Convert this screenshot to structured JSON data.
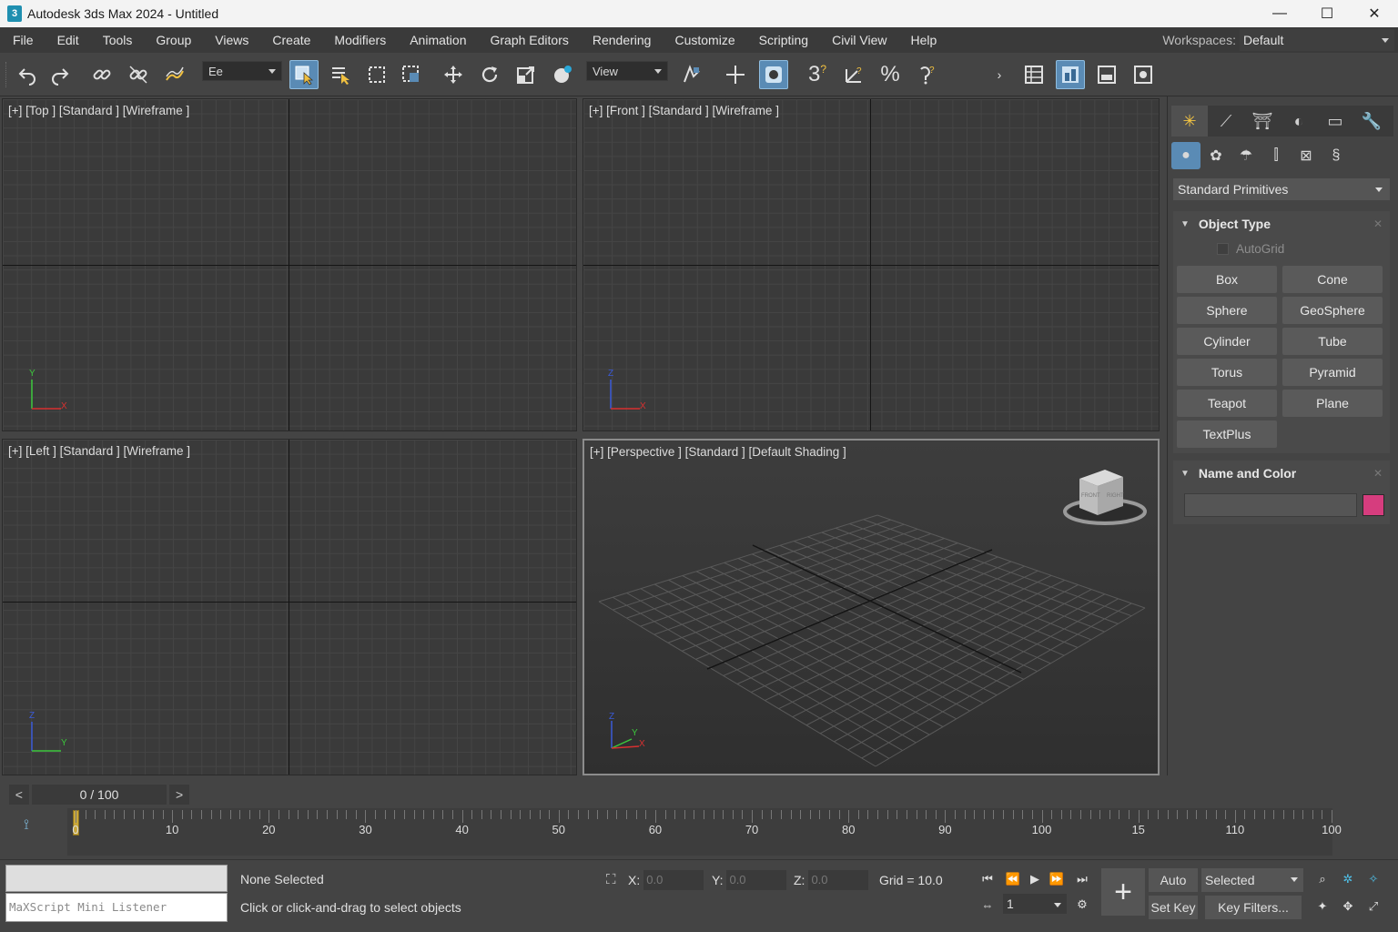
{
  "window": {
    "app_icon": "3",
    "title": "Autodesk 3ds Max 2024 - Untitled",
    "minimize": "—",
    "maximize": "☐",
    "close": "✕"
  },
  "menubar": {
    "items": [
      "File",
      "Edit",
      "Tools",
      "Group",
      "Views",
      "Create",
      "Modifiers",
      "Animation",
      "Graph Editors",
      "Rendering",
      "Customize",
      "Scripting",
      "Civil View",
      "Help"
    ],
    "workspaces_label": "Workspaces:",
    "workspaces_value": "Default"
  },
  "toolbar": {
    "selection_filter": "Ee",
    "reference_coord": "View",
    "snap_toggle_label": "3",
    "angle_snap_label": "?",
    "percent_snap_label": "%"
  },
  "viewports": {
    "top": "[+] [Top ] [Standard ] [Wireframe ]",
    "front": "[+] [Front ] [Standard ] [Wireframe ]",
    "left": "[+] [Left ] [Standard ] [Wireframe ]",
    "perspective": "[+] [Perspective ] [Standard ] [Default Shading ]",
    "axes": {
      "x": "X",
      "y": "Y",
      "z": "Z"
    },
    "viewcube_front": "FRONT",
    "viewcube_right": "RIGHT"
  },
  "command_panel": {
    "category_dropdown": "Standard Primitives",
    "object_type": {
      "title": "Object Type",
      "autogrid": "AutoGrid",
      "buttons": [
        "Box",
        "Cone",
        "Sphere",
        "GeoSphere",
        "Cylinder",
        "Tube",
        "Torus",
        "Pyramid",
        "Teapot",
        "Plane",
        "TextPlus"
      ]
    },
    "name_and_color": {
      "title": "Name and Color",
      "color": "#d63d7e"
    }
  },
  "timeline": {
    "slider_value": "0 / 100",
    "prev": "<",
    "next": ">",
    "tick_labels": [
      "0",
      "10",
      "20",
      "30",
      "40",
      "50",
      "60",
      "70",
      "80",
      "90",
      "100",
      "15",
      "110",
      "100"
    ]
  },
  "status": {
    "maxscript_placeholder": "MaXScript Mini Listener",
    "selection": "None Selected",
    "prompt": "Click or click-and-drag to select objects",
    "x_label": "X:",
    "x_value": "0.0",
    "y_label": "Y:",
    "y_value": "0.0",
    "z_label": "Z:",
    "z_value": "0.0",
    "grid": "Grid = 10.0",
    "frame_field": "1",
    "auto_key": "Auto Key",
    "set_key": "Set Key",
    "selected_dropdown": "Selected",
    "key_filters": "Key Filters..."
  },
  "colors": {
    "accent_blue": "#5a8bb5",
    "active_tab_yellow": "#f5c542",
    "frame_cursor": "#c9a83a"
  }
}
